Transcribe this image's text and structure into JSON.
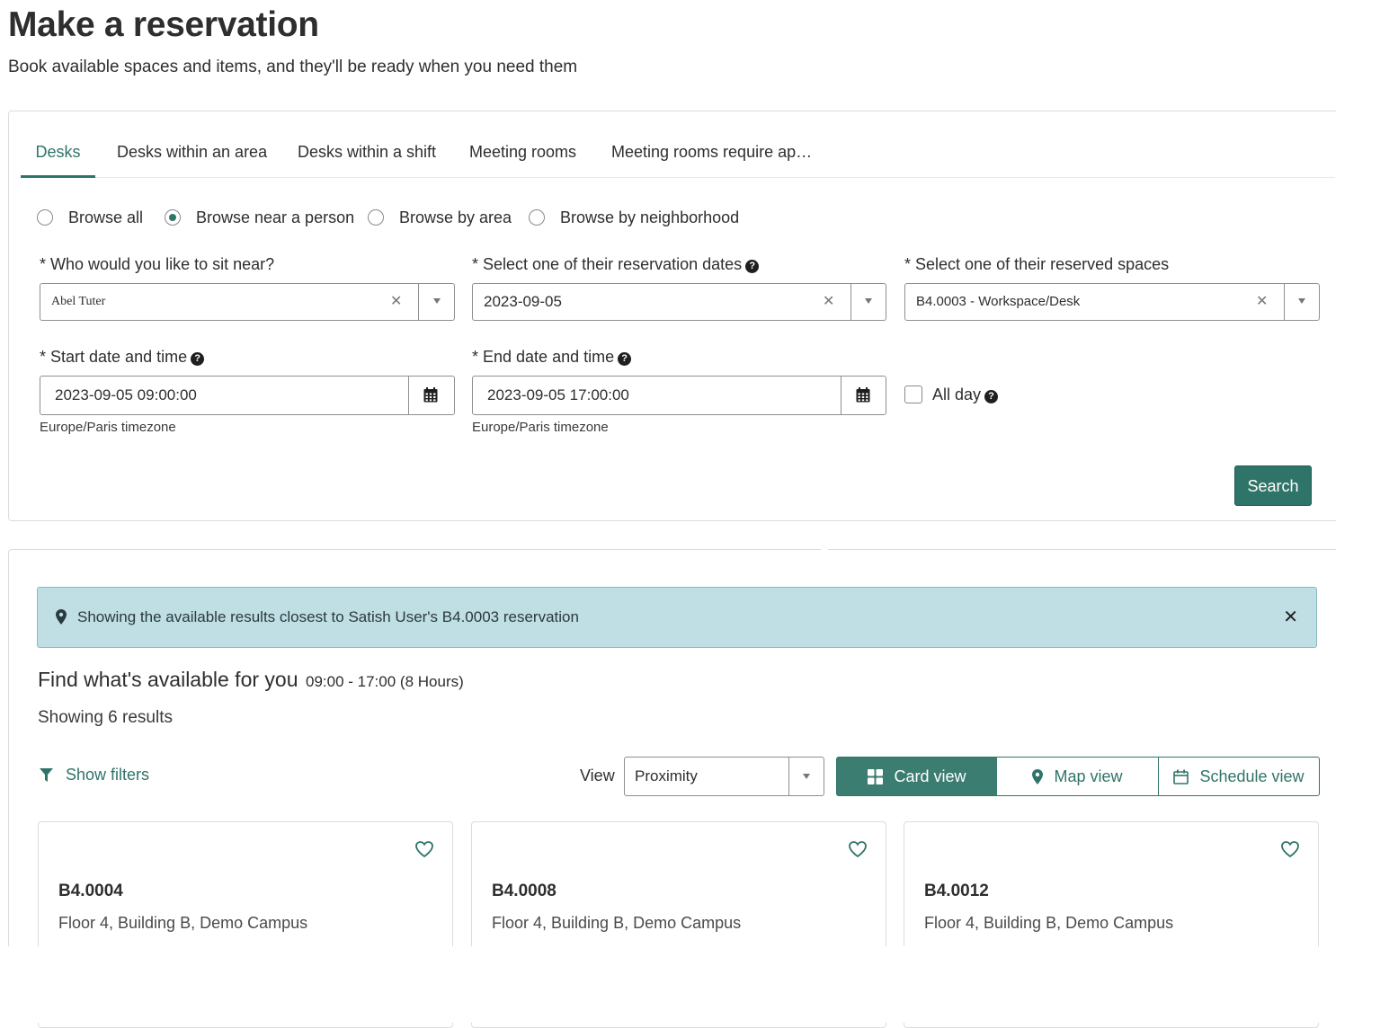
{
  "page": {
    "title": "Make a reservation",
    "subtitle": "Book available spaces and items, and they'll be ready when you need them"
  },
  "tabs": [
    {
      "label": "Desks"
    },
    {
      "label": "Desks within an area"
    },
    {
      "label": "Desks within a shift"
    },
    {
      "label": "Meeting rooms"
    },
    {
      "label": "Meeting rooms require ap…"
    }
  ],
  "browse_options": [
    {
      "label": "Browse all",
      "checked": false
    },
    {
      "label": "Browse near a person",
      "checked": true
    },
    {
      "label": "Browse by area",
      "checked": false
    },
    {
      "label": "Browse by neighborhood",
      "checked": false
    }
  ],
  "form": {
    "person_label": "* Who would you like to sit near?",
    "person_value": "Abel Tuter",
    "dates_label": "* Select one of their reservation dates",
    "dates_value": "2023-09-05",
    "spaces_label": "* Select one of their reserved spaces",
    "spaces_value": "B4.0003 - Workspace/Desk",
    "start_label": "* Start date and time",
    "start_value": "2023-09-05 09:00:00",
    "end_label": "* End date and time",
    "end_value": "2023-09-05 17:00:00",
    "timezone_note": "Europe/Paris timezone",
    "all_day_label": "All day",
    "search_label": "Search"
  },
  "results": {
    "alert_text": "Showing the available results closest to Satish User's B4.0003 reservation",
    "find_title": "Find what's available for you",
    "time_range": "09:00 - 17:00 (8 Hours)",
    "count_text": "Showing 6 results",
    "show_filters": "Show filters",
    "view_label": "View",
    "view_value": "Proximity",
    "view_modes": [
      {
        "label": "Card view",
        "active": true
      },
      {
        "label": "Map view",
        "active": false
      },
      {
        "label": "Schedule view",
        "active": false
      }
    ],
    "cards": [
      {
        "name": "B4.0004",
        "location": "Floor 4, Building B, Demo Campus"
      },
      {
        "name": "B4.0008",
        "location": "Floor 4, Building B, Demo Campus"
      },
      {
        "name": "B4.0012",
        "location": "Floor 4, Building B, Demo Campus"
      }
    ]
  },
  "colors": {
    "accent": "#2f7468",
    "alert_bg": "#bfdfe4",
    "alert_border": "#88b9c5"
  },
  "icons": [
    "help-icon",
    "clear-icon",
    "chevron-down-icon",
    "calendar-icon",
    "map-pin-icon",
    "close-icon",
    "filter-icon",
    "grid-icon",
    "heart-icon"
  ]
}
